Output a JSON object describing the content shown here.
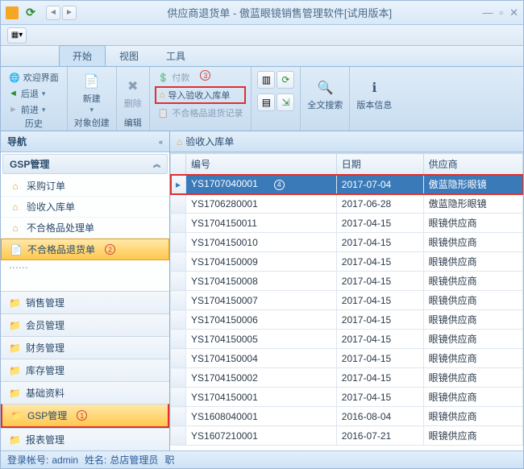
{
  "window": {
    "title": "供应商退货单 - 傲蓝眼镜销售管理软件[试用版本]"
  },
  "tabs": {
    "start": "开始",
    "view": "视图",
    "tools": "工具"
  },
  "ribbon": {
    "history": {
      "label": "历史",
      "welcome": "欢迎界面",
      "back": "后退",
      "forward": "前进"
    },
    "objcreate": {
      "label": "对象创建",
      "new": "新建"
    },
    "edit": {
      "label": "编辑",
      "delete": "删除"
    },
    "actions": {
      "pay": "付款",
      "import": "导入验收入库单",
      "rejectlog": "不合格品退货记录"
    },
    "search": "全文搜索",
    "version": "版本信息"
  },
  "doc_tab": "验收入库单",
  "nav": {
    "title": "导航",
    "section": "GSP管理",
    "tree": [
      {
        "label": "采购订单",
        "icon": "home"
      },
      {
        "label": "验收入库单",
        "icon": "home"
      },
      {
        "label": "不合格品处理单",
        "icon": "home"
      },
      {
        "label": "不合格品退货单",
        "icon": "doc",
        "selected": true,
        "badge": "2"
      }
    ],
    "cats": [
      {
        "label": "销售管理"
      },
      {
        "label": "会员管理"
      },
      {
        "label": "财务管理"
      },
      {
        "label": "库存管理"
      },
      {
        "label": "基础资料"
      },
      {
        "label": "GSP管理",
        "active": true,
        "badge": "1"
      },
      {
        "label": "报表管理"
      }
    ]
  },
  "grid": {
    "cols": {
      "rowhdr": "",
      "code": "编号",
      "date": "日期",
      "supplier": "供应商"
    },
    "rows": [
      {
        "code": "YS1707040001",
        "date": "2017-07-04",
        "supplier": "傲蓝隐形眼镜",
        "selected": true,
        "badge": "4"
      },
      {
        "code": "YS1706280001",
        "date": "2017-06-28",
        "supplier": "傲蓝隐形眼镜"
      },
      {
        "code": "YS1704150011",
        "date": "2017-04-15",
        "supplier": "眼镜供应商"
      },
      {
        "code": "YS1704150010",
        "date": "2017-04-15",
        "supplier": "眼镜供应商"
      },
      {
        "code": "YS1704150009",
        "date": "2017-04-15",
        "supplier": "眼镜供应商"
      },
      {
        "code": "YS1704150008",
        "date": "2017-04-15",
        "supplier": "眼镜供应商"
      },
      {
        "code": "YS1704150007",
        "date": "2017-04-15",
        "supplier": "眼镜供应商"
      },
      {
        "code": "YS1704150006",
        "date": "2017-04-15",
        "supplier": "眼镜供应商"
      },
      {
        "code": "YS1704150005",
        "date": "2017-04-15",
        "supplier": "眼镜供应商"
      },
      {
        "code": "YS1704150004",
        "date": "2017-04-15",
        "supplier": "眼镜供应商"
      },
      {
        "code": "YS1704150002",
        "date": "2017-04-15",
        "supplier": "眼镜供应商"
      },
      {
        "code": "YS1704150001",
        "date": "2017-04-15",
        "supplier": "眼镜供应商"
      },
      {
        "code": "YS1608040001",
        "date": "2016-08-04",
        "supplier": "眼镜供应商"
      },
      {
        "code": "YS1607210001",
        "date": "2016-07-21",
        "supplier": "眼镜供应商"
      }
    ]
  },
  "status": {
    "account_label": "登录帐号:",
    "account": "admin",
    "name_label": "姓名:",
    "name": "总店管理员",
    "role_label": "职"
  },
  "markers": {
    "m3": "3"
  }
}
